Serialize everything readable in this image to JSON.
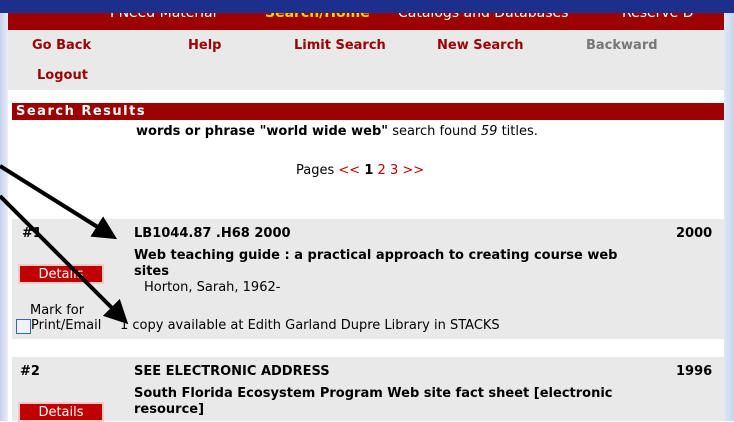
{
  "topnav": {
    "items": [
      "I Need Material",
      "Search/Home",
      "Catalogs and Databases",
      "Reserve D"
    ]
  },
  "subnav": {
    "go_back": "Go Back",
    "help": "Help",
    "limit_search": "Limit Search",
    "new_search": "New Search",
    "backward": "Backward",
    "logout": "Logout"
  },
  "results": {
    "header": "Search Results",
    "summary_prefix": "words or phrase ",
    "query": "\"world wide web\"",
    "summary_mid": " search found ",
    "count": "59",
    "summary_suffix": " titles."
  },
  "pagination": {
    "label": "Pages",
    "prev": "<<",
    "pages": [
      "1",
      "2",
      "3"
    ],
    "next": ">>"
  },
  "records": [
    {
      "num": "#1",
      "call_number": "LB1044.87 .H68 2000",
      "year": "2000",
      "title_line1": "Web teaching guide : a practical approach to creating course web",
      "title_line2": "sites",
      "author": "Horton, Sarah, 1962-",
      "details_label": "Details",
      "mark_line1": "Mark for",
      "mark_line2": "Print/Email",
      "availability": "1 copy available at Edith Garland Dupre Library in STACKS"
    },
    {
      "num": "#2",
      "call_number": "SEE ELECTRONIC ADDRESS",
      "year": "1996",
      "title_line1": "South Florida Ecosystem Program Web site fact sheet [electronic",
      "title_line2": "resource]",
      "details_label": "Details"
    }
  ],
  "colors": {
    "nav_red": "#9c0000",
    "active_gold": "#ffd700",
    "panel_gray": "#e9e9e9",
    "frame_blue": "#1c2f8c"
  }
}
